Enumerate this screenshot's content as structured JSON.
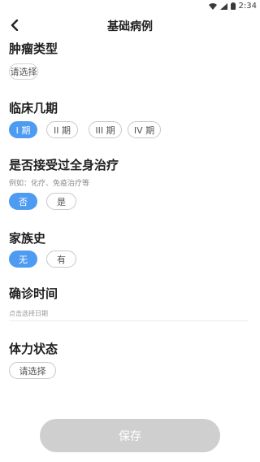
{
  "status_bar": {
    "time": "2:34"
  },
  "nav": {
    "title": "基础病例"
  },
  "tumor_type": {
    "title": "肿瘤类型",
    "select_label": "请选择"
  },
  "clinical_stage": {
    "title": "临床几期",
    "options": [
      "I 期",
      "II 期",
      "III 期",
      "IV 期"
    ],
    "selected_index": 0
  },
  "systemic_treatment": {
    "title": "是否接受过全身治疗",
    "hint": "例如：化疗、免疫治疗等",
    "options": [
      "否",
      "是"
    ],
    "selected_index": 0
  },
  "family_history": {
    "title": "家族史",
    "options": [
      "无",
      "有"
    ],
    "selected_index": 0
  },
  "diagnosis_time": {
    "title": "确诊时间",
    "placeholder": "点击选择日期"
  },
  "physical_status": {
    "title": "体力状态",
    "select_label": "请选择"
  },
  "footer": {
    "save_label": "保存"
  },
  "colors": {
    "accent": "#4e9bf2",
    "disabled_button": "#cfcfcf"
  }
}
